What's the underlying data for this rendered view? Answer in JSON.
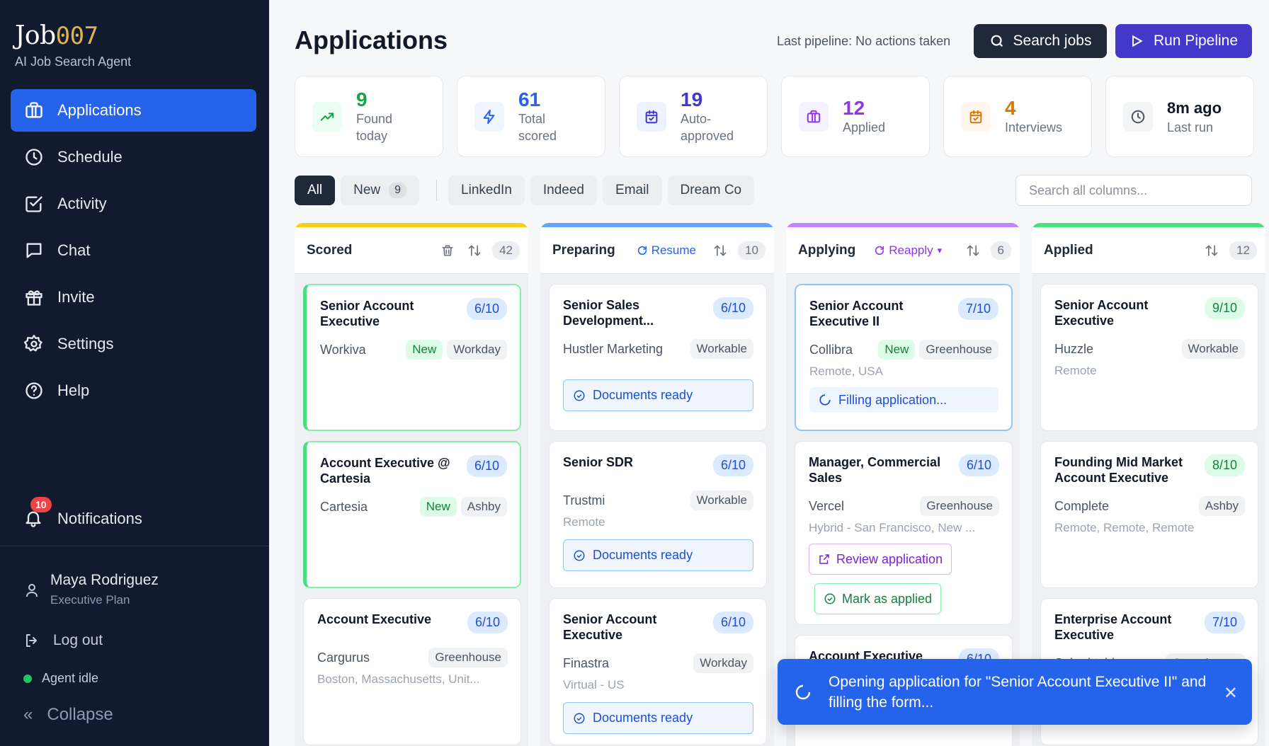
{
  "brand": {
    "name": "Job",
    "accent": "007",
    "tagline": "AI Job Search Agent"
  },
  "nav": {
    "items": [
      {
        "label": "Applications",
        "icon": "briefcase-icon"
      },
      {
        "label": "Schedule",
        "icon": "clock-icon"
      },
      {
        "label": "Activity",
        "icon": "check-square-icon"
      },
      {
        "label": "Chat",
        "icon": "chat-icon"
      },
      {
        "label": "Invite",
        "icon": "gift-icon"
      },
      {
        "label": "Settings",
        "icon": "gear-icon"
      },
      {
        "label": "Help",
        "icon": "help-icon"
      }
    ],
    "notifications": {
      "label": "Notifications",
      "count": "10"
    }
  },
  "user": {
    "name": "Maya Rodriguez",
    "plan": "Executive Plan"
  },
  "footer": {
    "logout": "Log out",
    "agent_status": "Agent idle",
    "collapse": "Collapse"
  },
  "header": {
    "title": "Applications",
    "last_pipeline": "Last pipeline: No actions taken",
    "search_jobs": "Search jobs",
    "run_pipeline": "Run Pipeline"
  },
  "stats": [
    {
      "value": "9",
      "label": "Found today",
      "color": "#16a34a",
      "bg": "#ecfdf3",
      "icon": "trend-up-icon"
    },
    {
      "value": "61",
      "label": "Total scored",
      "color": "#2563eb",
      "bg": "#eff6ff",
      "icon": "bolt-icon"
    },
    {
      "value": "19",
      "label": "Auto-approved",
      "color": "#4338ca",
      "bg": "#eef2ff",
      "icon": "calendar-check-icon"
    },
    {
      "value": "12",
      "label": "Applied",
      "color": "#9333ea",
      "bg": "#f5f3ff",
      "icon": "briefcase-icon"
    },
    {
      "value": "4",
      "label": "Interviews",
      "color": "#d97706",
      "bg": "#fff7ed",
      "icon": "calendar-check-icon"
    },
    {
      "value": "8m ago",
      "label": "Last run",
      "color": "#111827",
      "bg": "#f3f4f6",
      "icon": "clock-icon"
    }
  ],
  "filters": {
    "all": "All",
    "new": "New",
    "new_count": "9",
    "sources": [
      "LinkedIn",
      "Indeed",
      "Email",
      "Dream Co"
    ],
    "search_placeholder": "Search all columns..."
  },
  "columns": [
    {
      "title": "Scored",
      "count": "42",
      "accent": "#facc15",
      "cards": [
        {
          "title": "Senior Account Executive",
          "score": "6/10",
          "company": "Workiva",
          "tag": "New",
          "source": "Workday"
        },
        {
          "title": "Account Executive @ Cartesia",
          "score": "6/10",
          "company": "Cartesia",
          "tag": "New",
          "source": "Ashby"
        },
        {
          "title": "Account Executive",
          "score": "6/10",
          "company": "Cargurus",
          "source": "Greenhouse",
          "location": "Boston, Massachusetts, Unit..."
        }
      ]
    },
    {
      "title": "Preparing",
      "count": "10",
      "accent": "#60a5fa",
      "action": "Resume",
      "cards": [
        {
          "title": "Senior Sales Development...",
          "score": "6/10",
          "company": "Hustler Marketing",
          "source": "Workable",
          "status": "Documents ready"
        },
        {
          "title": "Senior SDR",
          "score": "6/10",
          "company": "Trustmi",
          "source": "Workable",
          "location": "Remote",
          "status": "Documents ready"
        },
        {
          "title": "Senior Account Executive",
          "score": "6/10",
          "company": "Finastra",
          "source": "Workday",
          "location": "Virtual - US",
          "status": "Documents ready"
        }
      ]
    },
    {
      "title": "Applying",
      "count": "6",
      "accent": "#c084fc",
      "action": "Reapply",
      "cards": [
        {
          "title": "Senior Account Executive II",
          "score": "7/10",
          "company": "Collibra",
          "tag": "New",
          "source": "Greenhouse",
          "location": "Remote, USA",
          "status": "Filling application..."
        },
        {
          "title": "Manager, Commercial Sales",
          "score": "6/10",
          "company": "Vercel",
          "source": "Greenhouse",
          "location": "Hybrid - San Francisco, New ...",
          "review": "Review application",
          "mark": "Mark as applied"
        },
        {
          "title": "Account Executive",
          "score": "6/10"
        }
      ]
    },
    {
      "title": "Applied",
      "count": "12",
      "accent": "#4ade80",
      "cards": [
        {
          "title": "Senior Account Executive",
          "score": "9/10",
          "company": "Huzzle",
          "source": "Workable",
          "location": "Remote"
        },
        {
          "title": "Founding Mid Market Account Executive",
          "score": "8/10",
          "company": "Complete",
          "source": "Ashby",
          "location": "Remote, Remote, Remote"
        },
        {
          "title": "Enterprise Account Executive",
          "score": "7/10",
          "company": "Submittable",
          "source": "Greenhouse"
        }
      ]
    }
  ],
  "toast": {
    "message": "Opening application for \"Senior Account Executive II\" and filling the form...",
    "close": "✕"
  }
}
